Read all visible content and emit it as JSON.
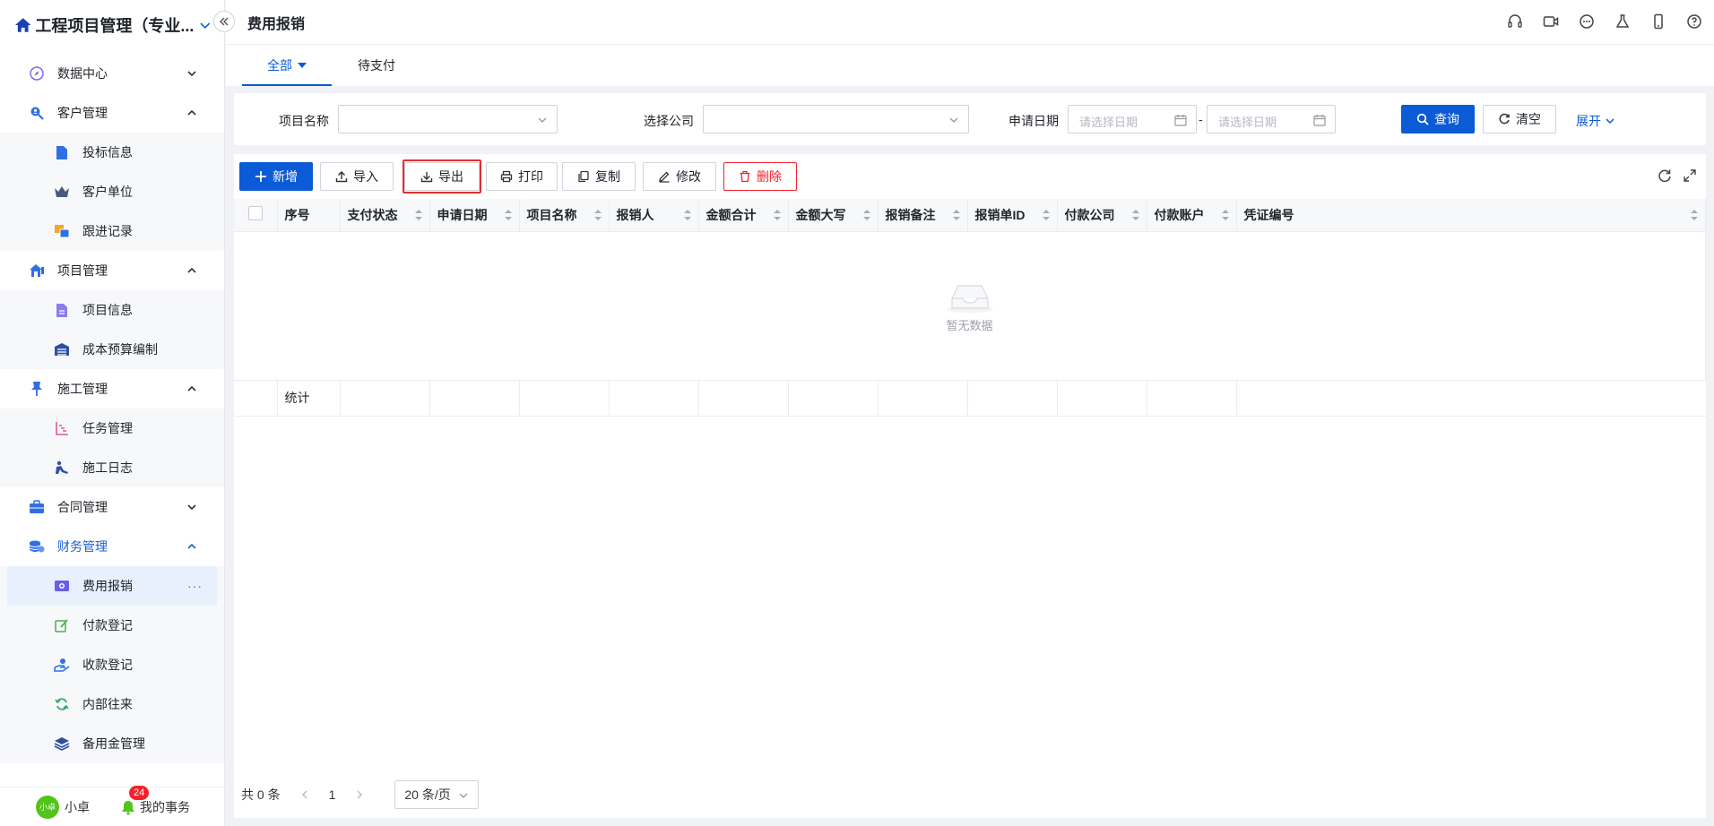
{
  "app": {
    "title": "工程项目管理（专业..."
  },
  "sidebar": {
    "groups": [
      {
        "label": "数据中心",
        "icon": "compass-icon",
        "expanded": false,
        "items": []
      },
      {
        "label": "客户管理",
        "icon": "user-search-icon",
        "expanded": true,
        "items": [
          {
            "label": "投标信息",
            "icon": "document-icon"
          },
          {
            "label": "客户单位",
            "icon": "crown-icon"
          },
          {
            "label": "跟进记录",
            "icon": "copy-icon"
          }
        ]
      },
      {
        "label": "项目管理",
        "icon": "house-icon",
        "expanded": true,
        "items": [
          {
            "label": "项目信息",
            "icon": "file-text-icon"
          },
          {
            "label": "成本预算编制",
            "icon": "warehouse-icon"
          }
        ]
      },
      {
        "label": "施工管理",
        "icon": "pin-icon",
        "expanded": true,
        "items": [
          {
            "label": "任务管理",
            "icon": "gantt-icon"
          },
          {
            "label": "施工日志",
            "icon": "worker-icon"
          }
        ]
      },
      {
        "label": "合同管理",
        "icon": "briefcase-icon",
        "expanded": false,
        "items": []
      },
      {
        "label": "财务管理",
        "icon": "coins-icon",
        "expanded": true,
        "active": true,
        "items": [
          {
            "label": "费用报销",
            "icon": "money-icon",
            "active": true,
            "more": "···"
          },
          {
            "label": "付款登记",
            "icon": "edit-icon"
          },
          {
            "label": "收款登记",
            "icon": "hand-coin-icon"
          },
          {
            "label": "内部往来",
            "icon": "refresh-icon"
          },
          {
            "label": "备用金管理",
            "icon": "layers-icon"
          }
        ]
      }
    ],
    "footer": {
      "avatar": "小卓",
      "user": "小卓",
      "badge": "24",
      "tasks": "我的事务"
    }
  },
  "topbar": {
    "title": "费用报销"
  },
  "tabs": [
    {
      "label": "全部",
      "active": true
    },
    {
      "label": "待支付",
      "active": false
    }
  ],
  "filter": {
    "project_label": "项目名称",
    "company_label": "选择公司",
    "date_label": "申请日期",
    "date_start_placeholder": "请选择日期",
    "date_sep": "-",
    "date_end_placeholder": "请选择日期",
    "query": "查询",
    "clear": "清空",
    "expand": "展开"
  },
  "toolbar": {
    "add": "新增",
    "import": "导入",
    "export": "导出",
    "print": "打印",
    "copy": "复制",
    "edit": "修改",
    "delete": "删除"
  },
  "table": {
    "columns": [
      "序号",
      "支付状态",
      "申请日期",
      "项目名称",
      "报销人",
      "金额合计",
      "金额大写",
      "报销备注",
      "报销单ID",
      "付款公司",
      "付款账户",
      "凭证编号"
    ],
    "empty_text": "暂无数据",
    "summary_label": "统计"
  },
  "pager": {
    "total": "共 0 条",
    "page": "1",
    "size": "20 条/页"
  },
  "colors": {
    "primary": "#0b5ad6",
    "danger": "#f5222d",
    "highlight": "#e03131"
  }
}
